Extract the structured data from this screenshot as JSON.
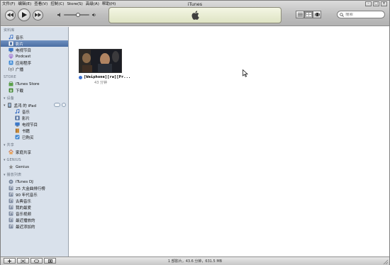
{
  "window": {
    "title": "iTunes",
    "menu": [
      "文件(F)",
      "编辑(E)",
      "查看(V)",
      "控制(C)",
      "Store(S)",
      "高级(A)",
      "帮助(H)"
    ]
  },
  "search": {
    "placeholder": "搜索"
  },
  "volume": {
    "level": 0.55
  },
  "sidebar": {
    "library": {
      "header": "资料库",
      "items": [
        {
          "label": "音乐",
          "icon": "music-note-icon"
        },
        {
          "label": "影片",
          "icon": "film-icon",
          "selected": true
        },
        {
          "label": "电视节目",
          "icon": "tv-icon"
        },
        {
          "label": "Podcast",
          "icon": "podcast-icon"
        },
        {
          "label": "应用程序",
          "icon": "app-icon"
        },
        {
          "label": "广播",
          "icon": "radio-icon"
        }
      ]
    },
    "store": {
      "header": "STORE",
      "items": [
        {
          "label": "iTunes Store",
          "icon": "store-icon"
        },
        {
          "label": "下载",
          "icon": "download-icon"
        }
      ]
    },
    "devices": {
      "header": "设备",
      "device_name": "孟鸿 的 iPad",
      "items": [
        {
          "label": "音乐",
          "icon": "music-note-icon"
        },
        {
          "label": "影片",
          "icon": "film-icon"
        },
        {
          "label": "电视节目",
          "icon": "tv-icon"
        },
        {
          "label": "书籍",
          "icon": "book-icon"
        },
        {
          "label": "已购买",
          "icon": "purchased-icon"
        }
      ]
    },
    "shared": {
      "header": "共享",
      "items": [
        {
          "label": "家庭共享",
          "icon": "home-icon"
        }
      ]
    },
    "genius": {
      "header": "GENIUS",
      "items": [
        {
          "label": "Genius",
          "icon": "genius-icon"
        }
      ]
    },
    "playlists": {
      "header": "播放列表",
      "items": [
        {
          "label": "iTunes DJ",
          "icon": "dj-icon"
        },
        {
          "label": "25 大金曲排行榜",
          "icon": "smart-playlist-icon"
        },
        {
          "label": "90 年代音乐",
          "icon": "smart-playlist-icon"
        },
        {
          "label": "古典音乐",
          "icon": "smart-playlist-icon"
        },
        {
          "label": "我的最爱",
          "icon": "smart-playlist-icon"
        },
        {
          "label": "音乐视频",
          "icon": "smart-playlist-icon"
        },
        {
          "label": "最近播放的",
          "icon": "smart-playlist-icon"
        },
        {
          "label": "最近添加的",
          "icon": "smart-playlist-icon"
        }
      ]
    }
  },
  "main": {
    "movies": [
      {
        "title": "[Weiphone][rw][Pr...",
        "duration": "43 分钟"
      }
    ]
  },
  "status_bar": {
    "text": "1 部影片，43.6 分钟，631.5 MB"
  },
  "colors": {
    "selection": "#4a6ea3",
    "sidebar_bg": "#d9e1eb",
    "lcd": "#e8ecd2"
  }
}
